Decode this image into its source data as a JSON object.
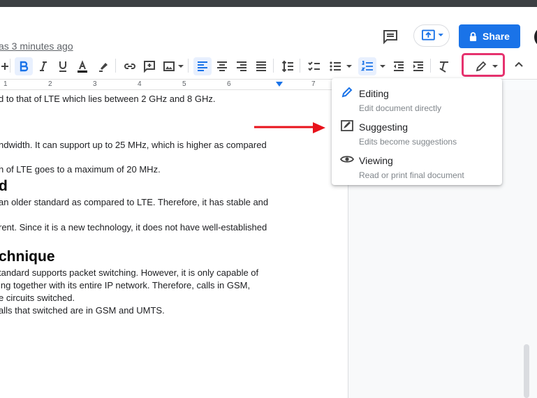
{
  "header": {
    "last_edit": "as 3 minutes ago",
    "share_label": "Share"
  },
  "ruler": {
    "numbers": [
      "1",
      "2",
      "3",
      "4",
      "5",
      "6",
      "7"
    ]
  },
  "document": {
    "lines": [
      "d to that of LTE which lies between 2 GHz and 8 GHz.",
      "ndwidth. It can support up to 25 MHz, which is higher as compared",
      "h of LTE goes to a maximum of 20 MHz.",
      "an older standard as compared to LTE. Therefore, it has stable and",
      "rent. Since it is a new technology, it does not have well-established",
      "tandard supports packet switching. However, it is only capable of",
      "ing together with its entire IP network. Therefore, calls in GSM,",
      "e circuits switched.",
      "alls that switched are in GSM and UMTS."
    ],
    "headings": [
      "d",
      "chnique"
    ]
  },
  "mode_menu": {
    "items": [
      {
        "title": "Editing",
        "desc": "Edit document directly",
        "icon": "pencil-icon"
      },
      {
        "title": "Suggesting",
        "desc": "Edits become suggestions",
        "icon": "suggest-edit-icon"
      },
      {
        "title": "Viewing",
        "desc": "Read or print final document",
        "icon": "eye-icon"
      }
    ]
  },
  "colors": {
    "accent": "#1a73e8",
    "highlight_box": "#e6326e",
    "arrow": "#e8121b",
    "active_tool_bg": "#e8f0fe"
  }
}
